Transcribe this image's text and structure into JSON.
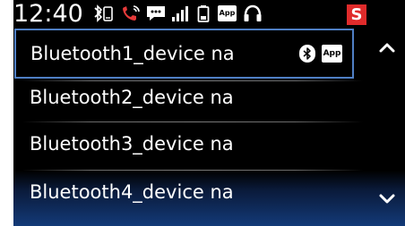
{
  "status_bar": {
    "time": "12:40",
    "icons": [
      "bluetooth-device-icon",
      "phone-call-icon",
      "message-icon",
      "signal-icon",
      "battery-icon",
      "app-icon",
      "headset-icon"
    ],
    "app_badge": "App",
    "s_badge": "S"
  },
  "devices": [
    {
      "label": "Bluetooth1_device na",
      "selected": true,
      "icons": [
        "bluetooth-icon",
        "app-icon"
      ],
      "app_badge": "App"
    },
    {
      "label": "Bluetooth2_device na"
    },
    {
      "label": "Bluetooth3_device na"
    },
    {
      "label": "Bluetooth4_device na",
      "highlighted": true
    }
  ],
  "colors": {
    "selection_border": "#4f7fc4",
    "highlight_bottom": "#133a78",
    "s_badge": "#e02b2b"
  }
}
